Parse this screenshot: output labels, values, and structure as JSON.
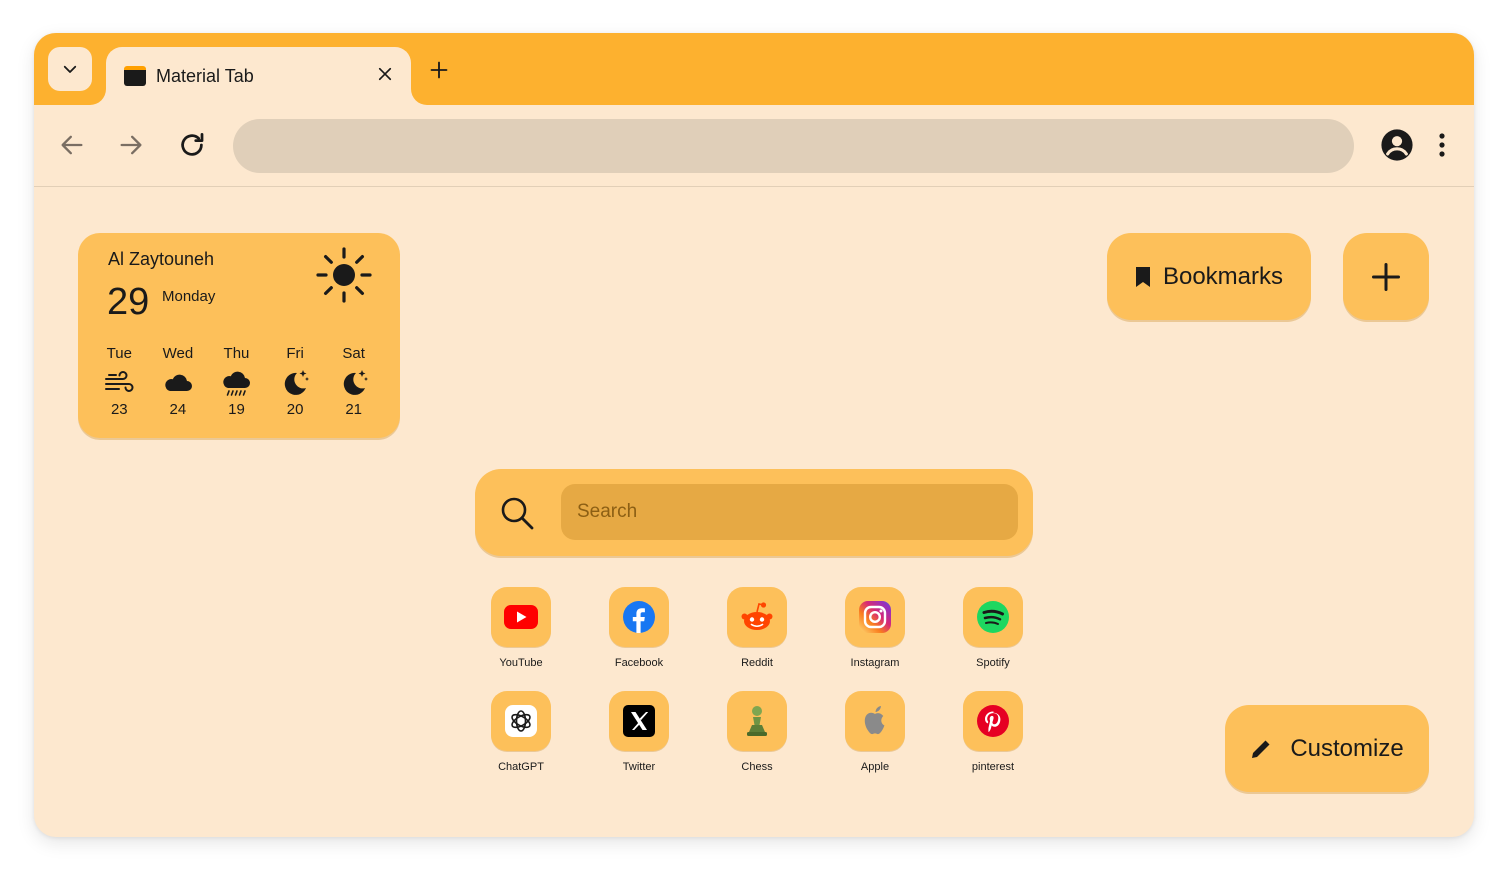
{
  "browser": {
    "tab": {
      "title": "Material Tab",
      "favicon": "window-icon"
    },
    "omnibox": {
      "value": ""
    },
    "colors": {
      "frame": "#fdb12f",
      "surface": "#fde8cf",
      "card": "#fdc05a",
      "omnibox": "#e0cfb9"
    }
  },
  "weather": {
    "location": "Al Zaytouneh",
    "temperature": "29",
    "day": "Monday",
    "current_icon": "sun-icon",
    "forecast": [
      {
        "day": "Tue",
        "temp": "23",
        "icon": "wind-icon"
      },
      {
        "day": "Wed",
        "temp": "24",
        "icon": "cloud-icon"
      },
      {
        "day": "Thu",
        "temp": "19",
        "icon": "rain-cloud-icon"
      },
      {
        "day": "Fri",
        "temp": "20",
        "icon": "moon-stars-icon"
      },
      {
        "day": "Sat",
        "temp": "21",
        "icon": "moon-stars-icon"
      }
    ]
  },
  "bookmarks": {
    "label": "Bookmarks"
  },
  "search": {
    "placeholder": "Search"
  },
  "shortcuts": [
    {
      "label": "YouTube",
      "icon": "youtube-icon"
    },
    {
      "label": "Facebook",
      "icon": "facebook-icon"
    },
    {
      "label": "Reddit",
      "icon": "reddit-icon"
    },
    {
      "label": "Instagram",
      "icon": "instagram-icon"
    },
    {
      "label": "Spotify",
      "icon": "spotify-icon"
    },
    {
      "label": "ChatGPT",
      "icon": "chatgpt-icon"
    },
    {
      "label": "Twitter",
      "icon": "x-icon"
    },
    {
      "label": "Chess",
      "icon": "chess-pawn-icon"
    },
    {
      "label": "Apple",
      "icon": "apple-icon"
    },
    {
      "label": "pinterest",
      "icon": "pinterest-icon"
    }
  ],
  "customize": {
    "label": "Customize"
  }
}
